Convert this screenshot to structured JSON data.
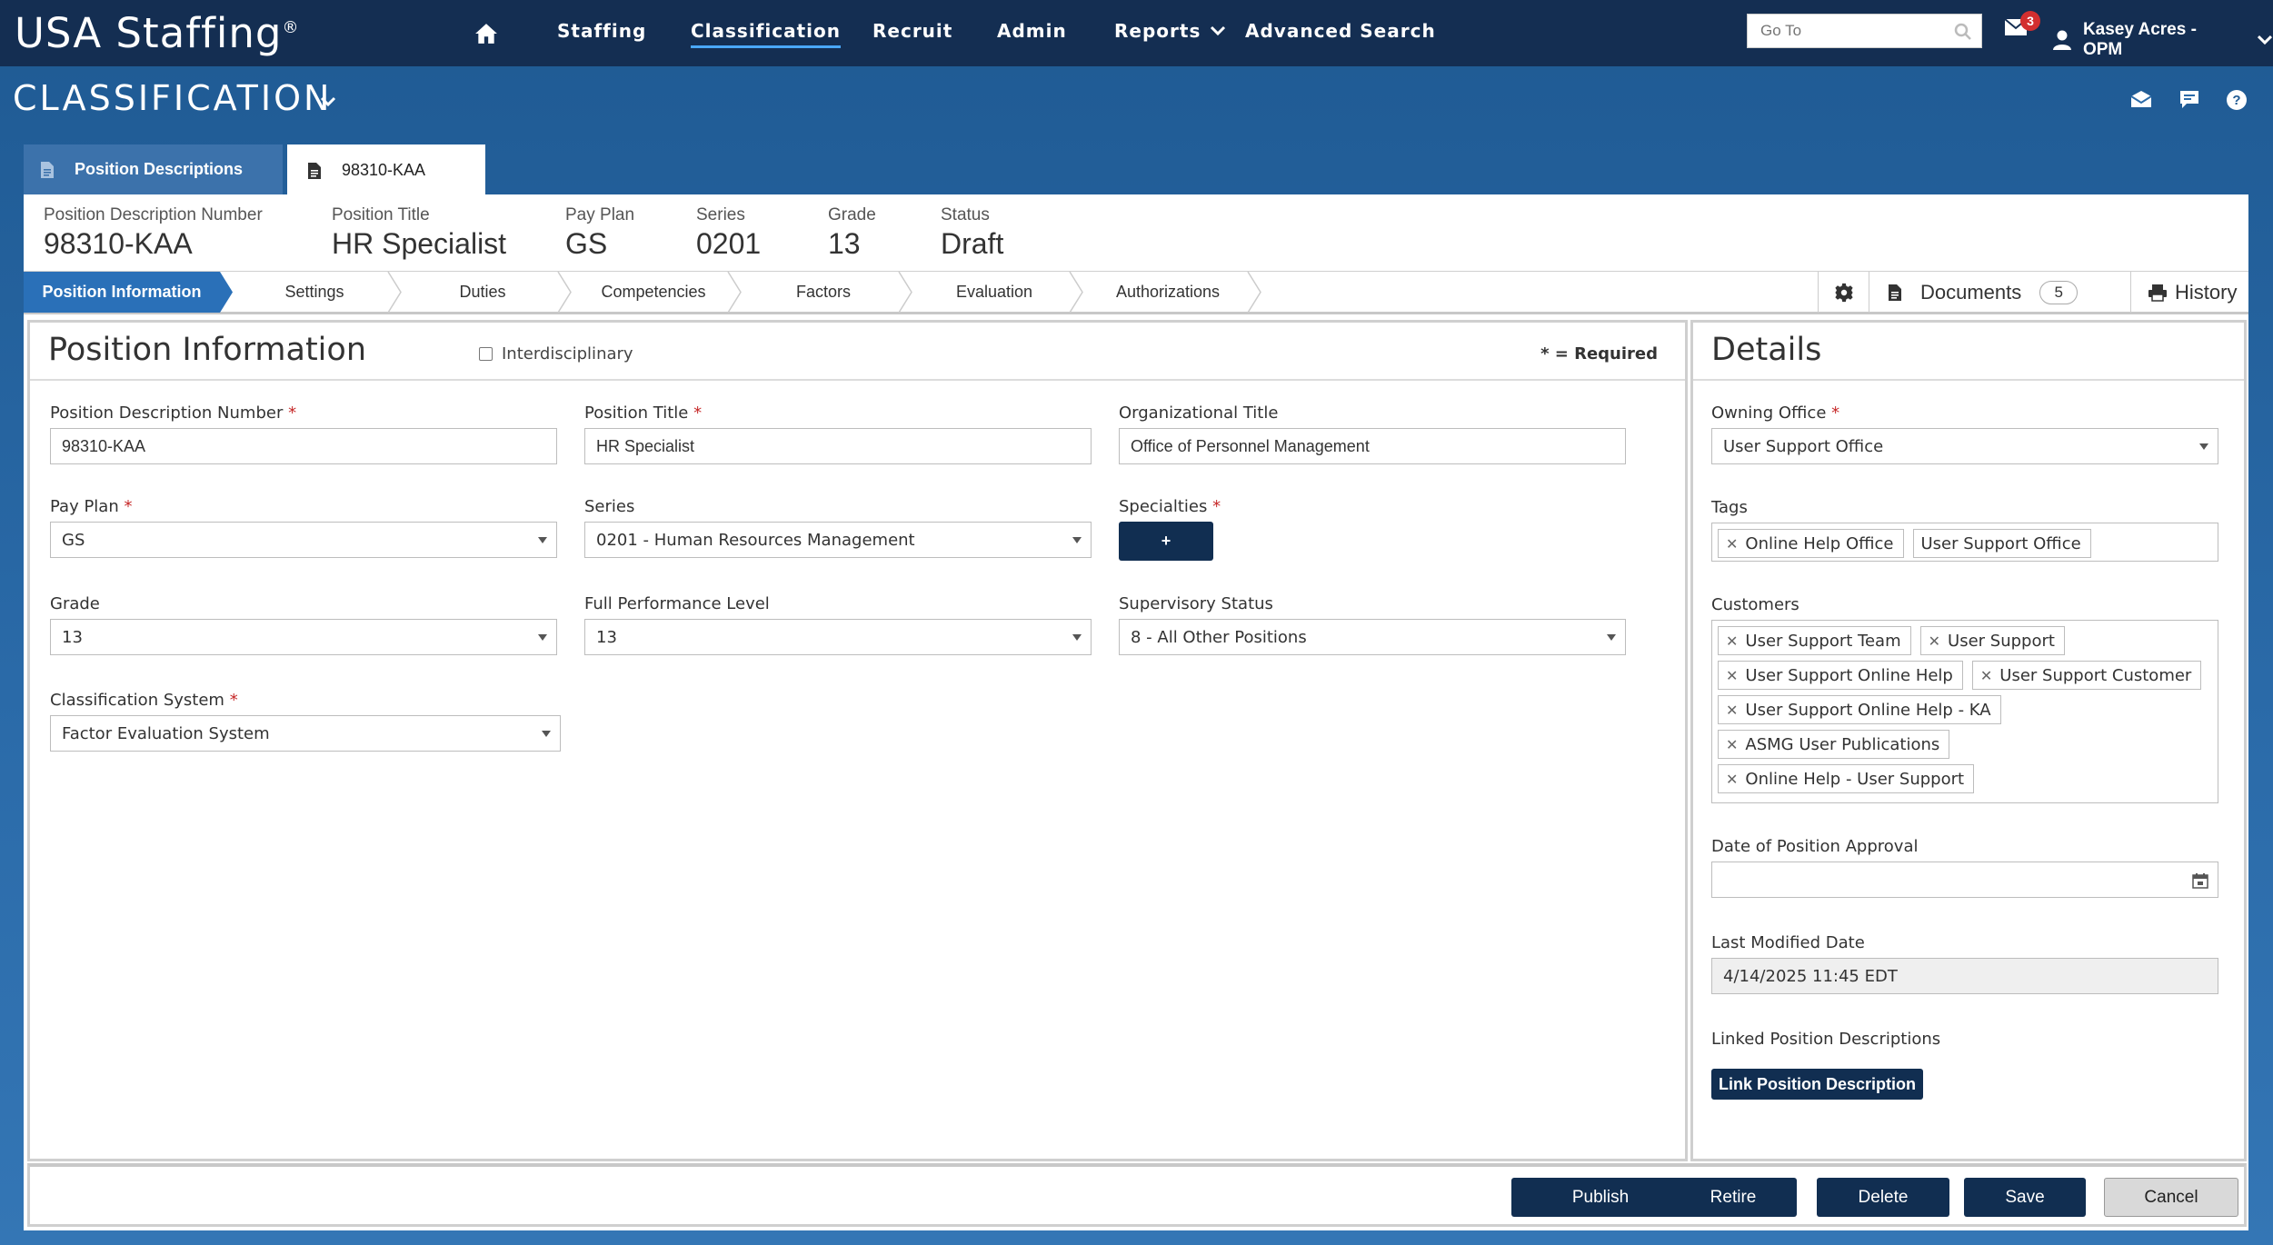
{
  "topnav": {
    "logo_text": "USA Staffing",
    "logo_mark": "®",
    "items": [
      "Staffing",
      "Classification",
      "Recruit",
      "Admin",
      "Reports",
      "Advanced Search"
    ],
    "goto_placeholder": "Go To",
    "mail_count": "3",
    "user_name": "Kasey Acres - OPM"
  },
  "module": {
    "title": "CLASSIFICATION"
  },
  "doc_tabs": {
    "list_label": "Position Descriptions",
    "current_label": "98310-KAA"
  },
  "summary": [
    {
      "label": "Position Description Number",
      "value": "98310-KAA"
    },
    {
      "label": "Position Title",
      "value": "HR Specialist"
    },
    {
      "label": "Pay Plan",
      "value": "GS"
    },
    {
      "label": "Series",
      "value": "0201"
    },
    {
      "label": "Grade",
      "value": "13"
    },
    {
      "label": "Status",
      "value": "Draft"
    }
  ],
  "steps": [
    "Position Information",
    "Settings",
    "Duties",
    "Competencies",
    "Factors",
    "Evaluation",
    "Authorizations"
  ],
  "tools": {
    "documents_label": "Documents",
    "documents_count": "5",
    "history_label": "History"
  },
  "position_info": {
    "title": "Position Information",
    "interdisciplinary_label": "Interdisciplinary",
    "required_note": "* = Required",
    "required_mark": "*",
    "fields": {
      "pd_number": {
        "label": "Position Description Number",
        "value": "98310-KAA"
      },
      "position_title": {
        "label": "Position Title",
        "value": "HR Specialist"
      },
      "org_title": {
        "label": "Organizational Title",
        "value": "Office of Personnel Management"
      },
      "pay_plan": {
        "label": "Pay Plan",
        "value": "GS"
      },
      "series": {
        "label": "Series",
        "value": "0201 - Human Resources Management"
      },
      "specialties": {
        "label": "Specialties",
        "button": "+"
      },
      "grade": {
        "label": "Grade",
        "value": "13"
      },
      "full_perf": {
        "label": "Full Performance Level",
        "value": "13"
      },
      "supervisory": {
        "label": "Supervisory Status",
        "value": "8 - All Other Positions"
      },
      "class_system": {
        "label": "Classification System",
        "value": "Factor Evaluation System"
      }
    }
  },
  "details": {
    "title": "Details",
    "owning_office": {
      "label": "Owning Office",
      "value": "User Support Office"
    },
    "tags": {
      "label": "Tags",
      "items": [
        "Online Help Office",
        "User Support Office"
      ]
    },
    "customers": {
      "label": "Customers",
      "items": [
        "User Support Team",
        "User Support",
        "User Support Online Help",
        "User Support Customer",
        "User Support Online Help - KA",
        "ASMG User Publications",
        "Online Help - User Support"
      ]
    },
    "approval_date": {
      "label": "Date of Position Approval",
      "value": ""
    },
    "last_modified": {
      "label": "Last Modified Date",
      "value": "4/14/2025 11:45 EDT"
    },
    "linked": {
      "label": "Linked Position Descriptions",
      "button": "Link Position Description"
    }
  },
  "footer": {
    "buttons": [
      "Publish",
      "Retire",
      "Delete",
      "Save",
      "Cancel"
    ]
  }
}
